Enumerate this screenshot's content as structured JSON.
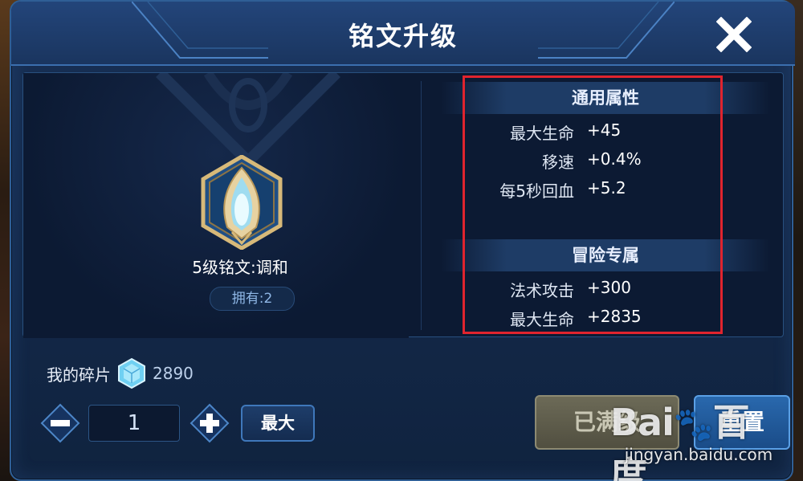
{
  "dialog": {
    "title": "铭文升级",
    "close_icon": "close-icon"
  },
  "rune": {
    "icon": "rune-crest-icon",
    "name": "5级铭文:调和",
    "owned": "拥有:2"
  },
  "attributes": {
    "general": {
      "header": "通用属性",
      "rows": [
        {
          "label": "最大生命",
          "value": "+45"
        },
        {
          "label": "移速",
          "value": "+0.4%"
        },
        {
          "label": "每5秒回血",
          "value": "+5.2"
        }
      ]
    },
    "adventure": {
      "header": "冒险专属",
      "rows": [
        {
          "label": "法术攻击",
          "value": "+300"
        },
        {
          "label": "最大生命",
          "value": "+2835"
        }
      ]
    }
  },
  "fragments": {
    "label": "我的碎片",
    "icon": "crystal-icon",
    "count": "2890"
  },
  "stepper": {
    "minus_icon": "minus-icon",
    "plus_icon": "plus-icon",
    "quantity": "1",
    "max_label": "最大"
  },
  "actions": {
    "maxed_label": "已满级",
    "reset_label": "重置"
  },
  "watermark": {
    "logo": "Baidu",
    "url": "jingyan.baidu.com"
  },
  "colors": {
    "highlight": "#e0242e",
    "panel_bg": "#0c1a33",
    "accent_blue": "#3f78bb",
    "disabled_button": "#6c6a57"
  }
}
